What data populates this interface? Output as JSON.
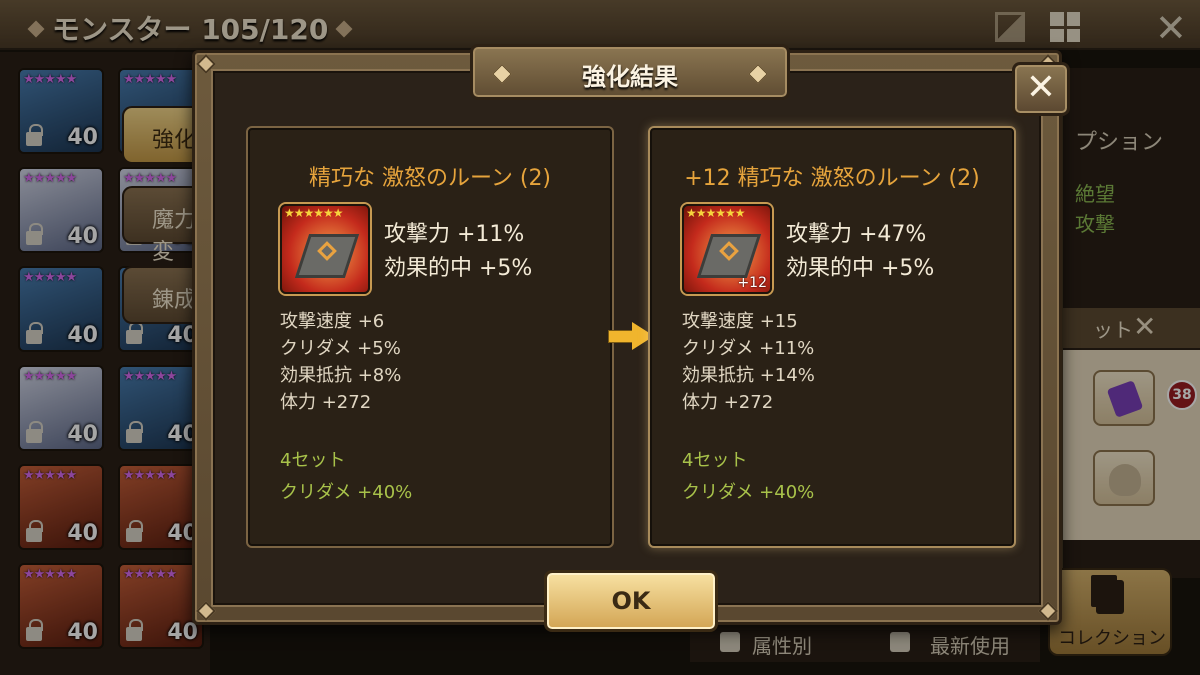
{
  "header": {
    "title": "モンスター 105/120"
  },
  "monster_cards": [
    {
      "level": "40",
      "stars": "★★★★★"
    },
    {
      "level": "40",
      "stars": "★★★★★"
    },
    {
      "level": "40",
      "stars": "★★★★★"
    },
    {
      "level": "40",
      "stars": "★★★★★"
    },
    {
      "level": "40",
      "stars": "★★★★★"
    },
    {
      "level": "40",
      "stars": "★★★★★"
    },
    {
      "level": "40",
      "stars": "★★★★★"
    },
    {
      "level": "40",
      "stars": "★★★★★"
    },
    {
      "level": "40",
      "stars": "★★★★★"
    },
    {
      "level": "40",
      "stars": "★★★★★"
    },
    {
      "level": "40",
      "stars": "★★★★★"
    },
    {
      "level": "40",
      "stars": "★★★★★"
    }
  ],
  "side_tabs": [
    "強化",
    "魔力変",
    "錬成"
  ],
  "right_panel": {
    "option_label": "プション",
    "green_1": "絶望",
    "green_2": "攻撃",
    "set_label": "ット",
    "item_badge": "38",
    "collection_label": "コレクション"
  },
  "bottom_bar": {
    "filter_1": "属性別",
    "filter_2": "最新使用"
  },
  "dialog": {
    "title": "強化結果",
    "ok_label": "OK",
    "before": {
      "name": "精巧な 激怒のルーン (2)",
      "stars": "★★★★★★",
      "plus": "",
      "main_stat_1": "攻撃力 +11%",
      "main_stat_2": "効果的中 +5%",
      "substats": [
        "攻撃速度 +6",
        "クリダメ +5%",
        "効果抵抗 +8%",
        "体力 +272"
      ],
      "set_title": "4セット",
      "set_effect": "クリダメ +40%"
    },
    "after": {
      "name": "+12 精巧な 激怒のルーン (2)",
      "stars": "★★★★★★",
      "plus": "+12",
      "main_stat_1": "攻撃力 +47%",
      "main_stat_2": "効果的中 +5%",
      "substats": [
        "攻撃速度 +15",
        "クリダメ +11%",
        "効果抵抗 +14%",
        "体力 +272"
      ],
      "set_title": "4セット",
      "set_effect": "クリダメ +40%"
    }
  },
  "icons": {
    "close": "✕",
    "arrow": "right-arrow-icon"
  },
  "colors": {
    "rune_name": "#e6a43c",
    "set_text": "#a8c24a",
    "arrow": "#f0b52d"
  }
}
